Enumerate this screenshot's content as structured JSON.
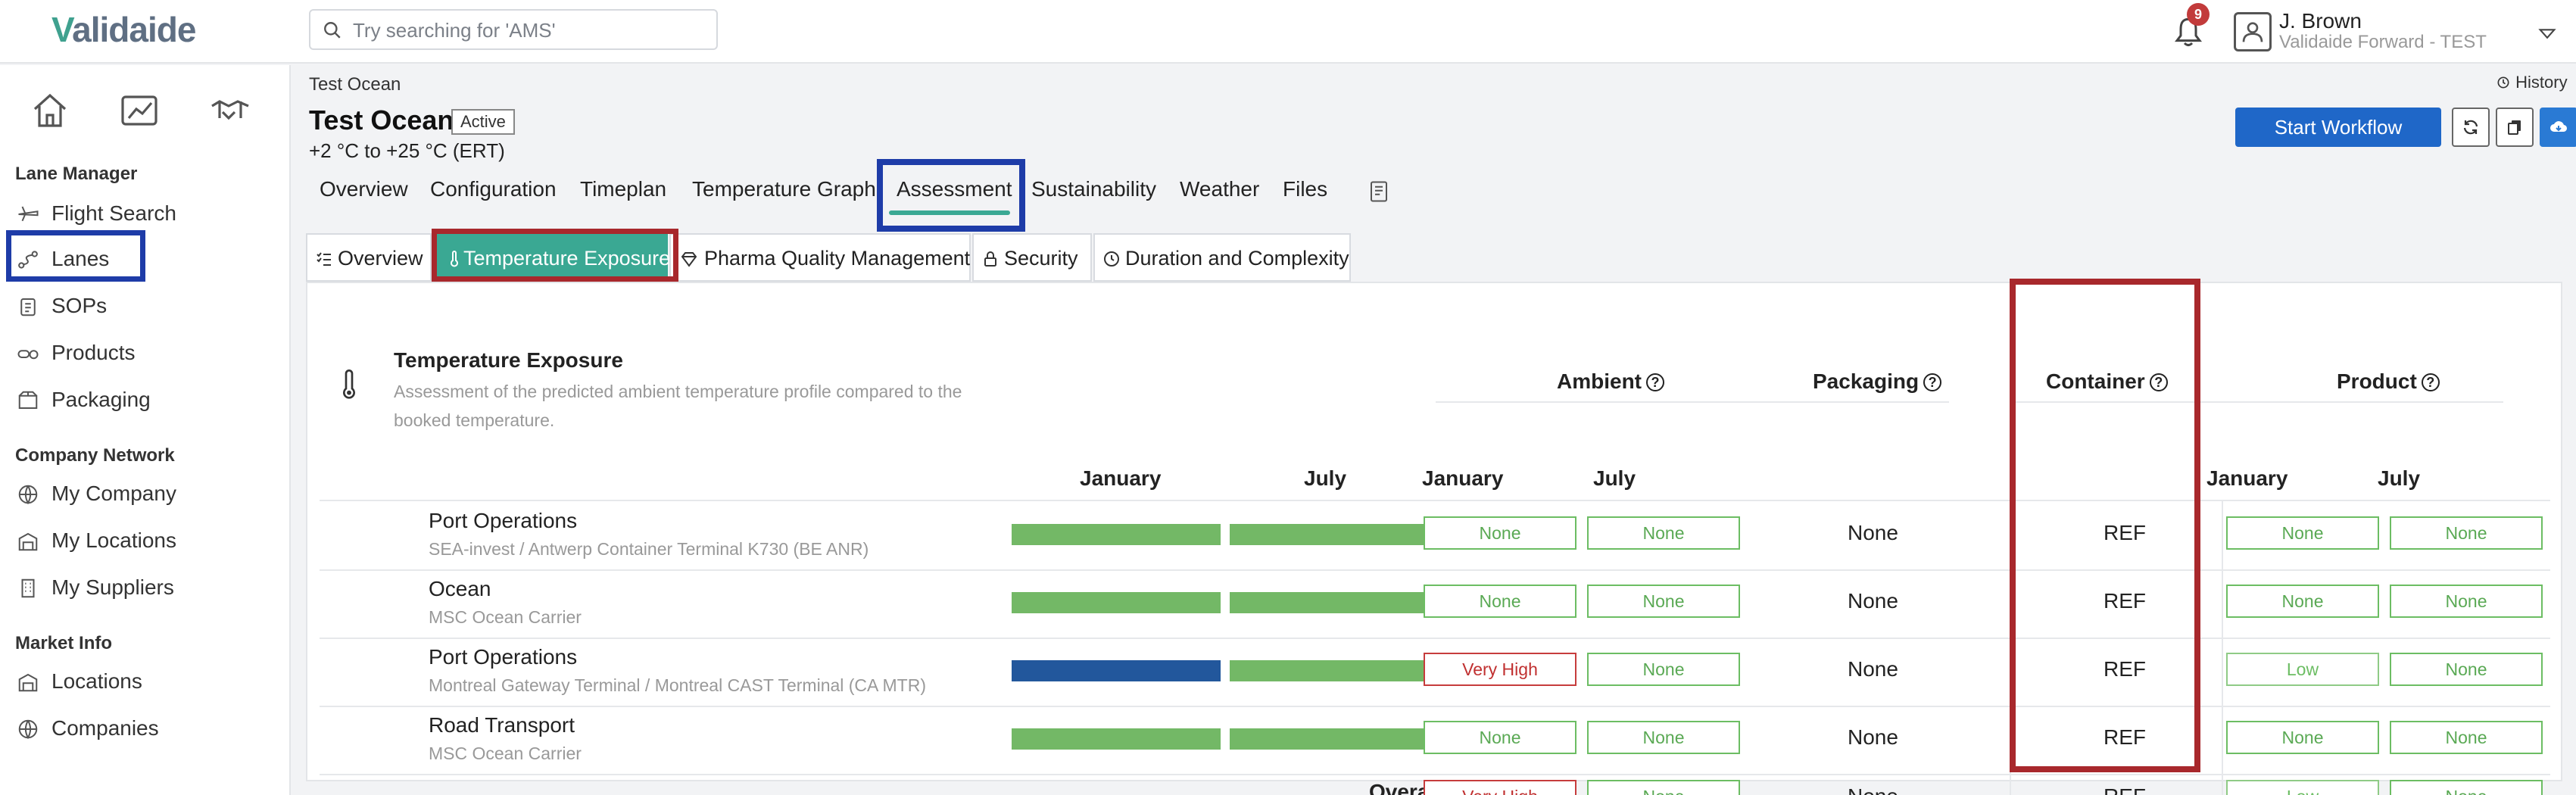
{
  "app": {
    "logo_text": "alidaide",
    "search": {
      "placeholder": "Try searching for 'AMS'"
    },
    "notifications": {
      "count": "9"
    },
    "user": {
      "name": "J. Brown",
      "org": "Validaide Forward - TEST"
    }
  },
  "sidebar": {
    "sections": [
      {
        "title": "Lane Manager",
        "items": [
          "Flight Search",
          "Lanes",
          "SOPs",
          "Products",
          "Packaging"
        ]
      },
      {
        "title": "Company Network",
        "items": [
          "My Company",
          "My Locations",
          "My Suppliers"
        ]
      },
      {
        "title": "Market Info",
        "items": [
          "Locations",
          "Companies"
        ]
      }
    ]
  },
  "header": {
    "breadcrumb": "Test Ocean",
    "title": "Test Ocean",
    "status": "Active",
    "temp_range": "+2 °C to +25 °C (ERT)",
    "history": "History",
    "start_workflow": "Start Workflow"
  },
  "tabs": [
    "Overview",
    "Configuration",
    "Timeplan",
    "Temperature Graph",
    "Assessment",
    "Sustainability",
    "Weather",
    "Files"
  ],
  "subtabs": [
    "Overview",
    "Temperature Exposure",
    "Pharma Quality Management",
    "Security",
    "Duration and Complexity"
  ],
  "assessment": {
    "section_title": "Temperature Exposure",
    "section_desc": "Assessment of the predicted ambient temperature profile compared to the booked temperature.",
    "columns": {
      "ambient": "Ambient",
      "packaging": "Packaging",
      "container": "Container",
      "product": "Product"
    },
    "months": [
      "January",
      "July"
    ],
    "rows": [
      {
        "title": "Port Operations",
        "subtitle": "SEA-invest / Antwerp Container Terminal K730 (BE ANR)",
        "icon": "anchor-icon",
        "bars": [
          "#73b866",
          "#73b866"
        ],
        "ambient": [
          "None",
          "None"
        ],
        "ambient_style": [
          "green",
          "green"
        ],
        "packaging": "None",
        "container": "REF",
        "product": [
          "None",
          "None"
        ],
        "product_style": [
          "green",
          "green"
        ]
      },
      {
        "title": "Ocean",
        "subtitle": "MSC Ocean Carrier",
        "icon": "ship-icon",
        "bars": [
          "#73b866",
          "#73b866"
        ],
        "ambient": [
          "None",
          "None"
        ],
        "ambient_style": [
          "green",
          "green"
        ],
        "packaging": "None",
        "container": "REF",
        "product": [
          "None",
          "None"
        ],
        "product_style": [
          "green",
          "green"
        ]
      },
      {
        "title": "Port Operations",
        "subtitle": "Montreal Gateway Terminal / Montreal CAST Terminal (CA MTR)",
        "icon": "anchor-icon",
        "bars": [
          "#22579c",
          "#73b866"
        ],
        "ambient": [
          "Very High",
          "None"
        ],
        "ambient_style": [
          "red",
          "green"
        ],
        "packaging": "None",
        "container": "REF",
        "product": [
          "Low",
          "None"
        ],
        "product_style": [
          "lowgreen",
          "green"
        ]
      },
      {
        "title": "Road Transport",
        "subtitle": "MSC Ocean Carrier",
        "icon": "truck-icon",
        "bars": [
          "#73b866",
          "#73b866"
        ],
        "ambient": [
          "None",
          "None"
        ],
        "ambient_style": [
          "green",
          "green"
        ],
        "packaging": "None",
        "container": "REF",
        "product": [
          "None",
          "None"
        ],
        "product_style": [
          "green",
          "green"
        ]
      }
    ],
    "overall": {
      "label": "Overall",
      "ambient": [
        "Very High",
        "None"
      ],
      "ambient_style": [
        "red",
        "green"
      ],
      "packaging": "None",
      "container": "REF",
      "product": [
        "Low",
        "None"
      ],
      "product_style": [
        "lowgreen",
        "green"
      ]
    }
  }
}
